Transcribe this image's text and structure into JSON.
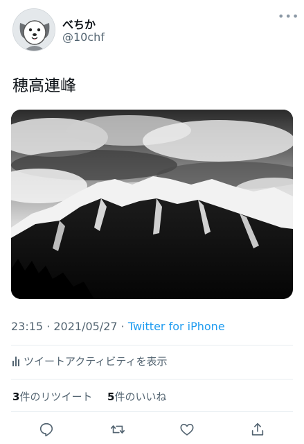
{
  "user": {
    "display_name": "べちか",
    "handle": "@10chf"
  },
  "tweet": {
    "text": "穂高連峰",
    "image_icon": "mountain-photo"
  },
  "meta": {
    "time": "23:15",
    "separator1": " · ",
    "date": "2021/05/27",
    "separator2": " · ",
    "source": "Twitter for iPhone"
  },
  "activity": {
    "label": "ツイートアクティビティを表示"
  },
  "stats": {
    "retweets_count": "3",
    "retweets_label": "件のリツイート",
    "likes_count": "5",
    "likes_label": "件のいいね"
  },
  "icons": {
    "more": "more-icon",
    "reply": "reply-icon",
    "retweet": "retweet-icon",
    "like": "like-icon",
    "share": "share-icon"
  },
  "colors": {
    "text": "#0f1419",
    "secondary": "#536471",
    "link": "#1d9bf0",
    "divider": "#e6ecf0"
  }
}
